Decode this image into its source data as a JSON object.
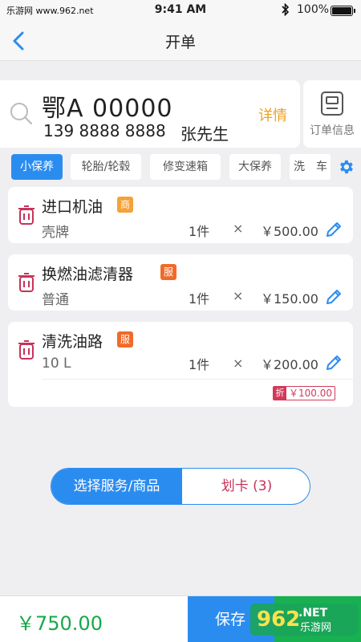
{
  "status_bar": {
    "carrier": "乐游网 www.962.net",
    "time": "9:41 AM",
    "battery": "100%"
  },
  "nav": {
    "title": "开单"
  },
  "customer": {
    "plate": "鄂A 00000",
    "phone": "139 8888 8888",
    "name": "张先生",
    "detail_label": "详情"
  },
  "order_info": {
    "label": "订单信息"
  },
  "tabs": [
    {
      "label": "小保养",
      "active": true
    },
    {
      "label": "轮胎/轮毂",
      "active": false
    },
    {
      "label": "修变速箱",
      "active": false
    },
    {
      "label": "大保养",
      "active": false
    },
    {
      "label": "洗　车",
      "active": false
    }
  ],
  "items": [
    {
      "name": "进口机油",
      "tag": "商",
      "tag_color": "#f4a23a",
      "sub": "壳牌",
      "qty": "1件",
      "times": "×",
      "price": "￥500.00"
    },
    {
      "name": "换燃油滤清器",
      "tag": "服",
      "tag_color": "#f06a2a",
      "sub": "普通",
      "qty": "1件",
      "times": "×",
      "price": "￥150.00"
    },
    {
      "name": "清洗油路",
      "tag": "服",
      "tag_color": "#f06a2a",
      "sub": "10 L",
      "qty": "1件",
      "times": "×",
      "price": "￥200.00",
      "discount_tag": "折",
      "discount": "￥100.00"
    }
  ],
  "segment": {
    "left": "选择服务/商品",
    "right": "划卡 (3)"
  },
  "bottom": {
    "total": "￥750.00",
    "save": "保存"
  },
  "watermark": {
    "brand": "962",
    "sub": "乐游网"
  },
  "colors": {
    "accent": "#2b8cf0",
    "total": "#17a84a",
    "detail": "#f0a020",
    "trash": "#c8325a"
  }
}
